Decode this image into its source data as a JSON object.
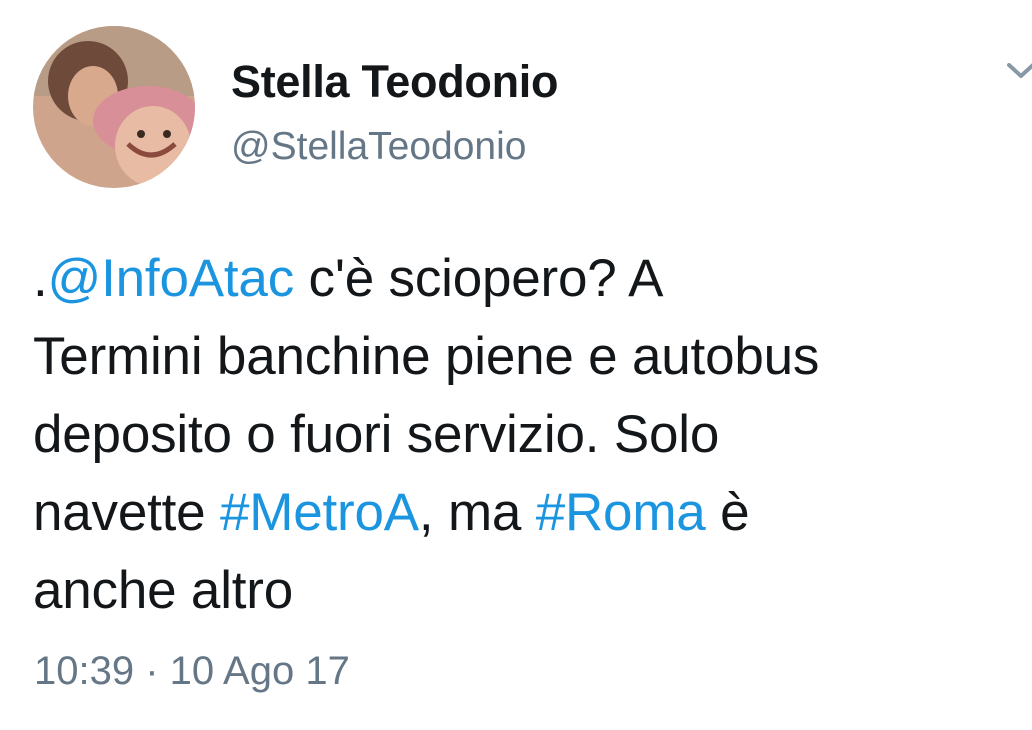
{
  "user": {
    "display_name": "Stella Teodonio",
    "handle": "@StellaTeodonio",
    "avatar": "profile-photo"
  },
  "menu_icon": "chevron-down-icon",
  "tweet": {
    "line1_prefix": ".",
    "line1_mention": "@InfoAtac",
    "line1_text": " c'è sciopero? A",
    "line2_text": "Termini banchine piene e autobus",
    "line3_text": "deposito o fuori servizio. Solo",
    "line4_text_a": "navette ",
    "line4_hashtag1": "#MetroA",
    "line4_text_b": ", ma ",
    "line4_hashtag2": "#Roma",
    "line4_text_c": " è",
    "line5_text": "anche altro"
  },
  "timestamp": "10:39 · 10 Ago 17",
  "colors": {
    "link": "#1b95e0",
    "text": "#14171a",
    "secondary": "#657786"
  }
}
